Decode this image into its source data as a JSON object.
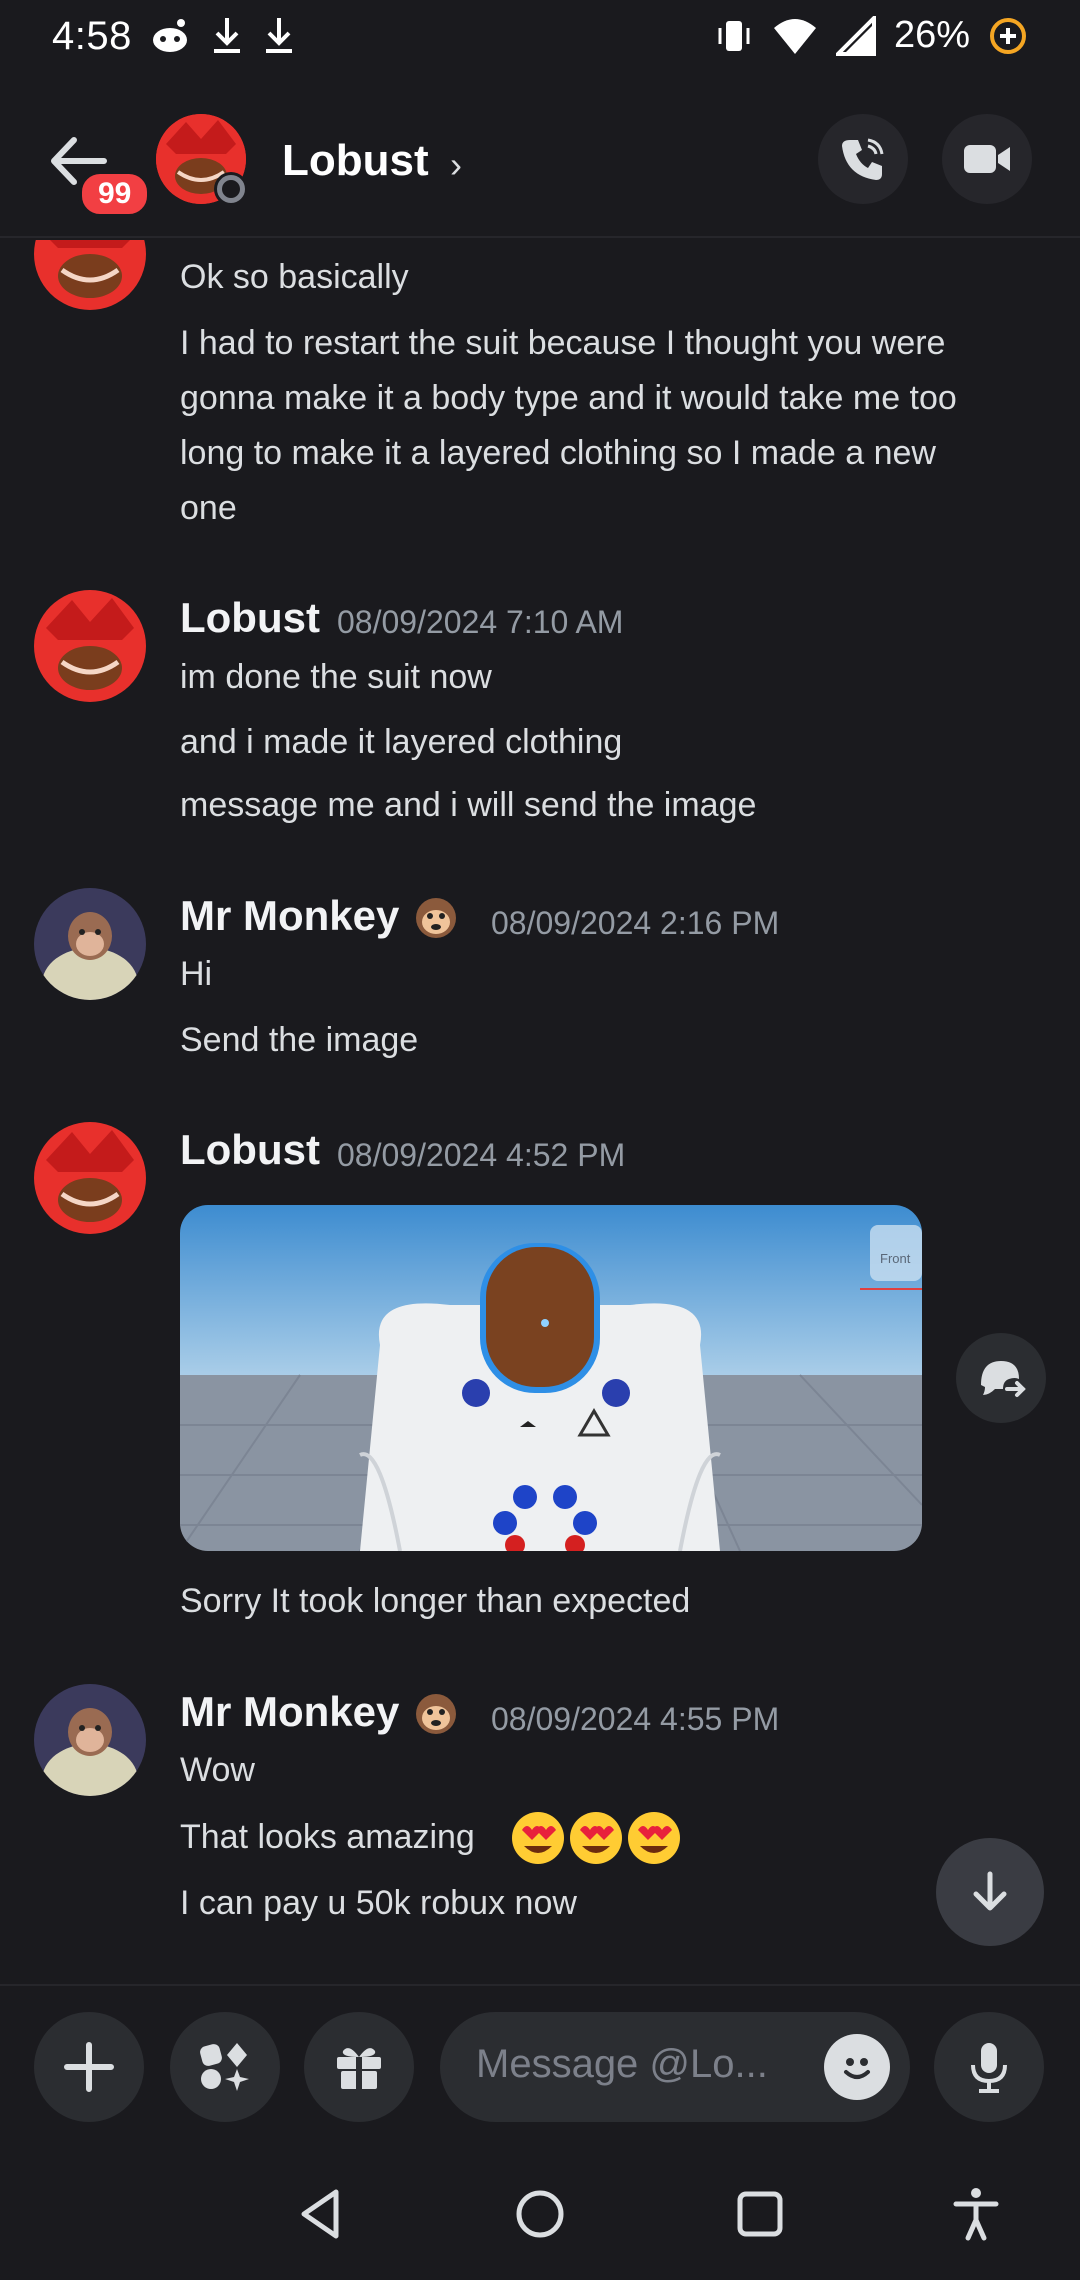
{
  "status_bar": {
    "time": "4:58",
    "battery": "26%"
  },
  "header": {
    "unread_count": "99",
    "name": "Lobust",
    "chevron": "›"
  },
  "messages": [
    {
      "id": "cont",
      "lines": [
        "Ok so basically",
        "I had to restart the suit because I thought you were",
        "gonna make it a body type and it would take me too",
        "long to make it a layered clothing so I made a new",
        "one"
      ]
    },
    {
      "id": "m1",
      "author": "Lobust",
      "timestamp": "08/09/2024 7:10 AM",
      "lines": [
        "im done the suit now",
        "and i made it layered clothing",
        "message me and i will send the image"
      ]
    },
    {
      "id": "m2",
      "author": "Mr Monkey",
      "author_emoji": "🐵",
      "timestamp": "08/09/2024 2:16 PM",
      "lines": [
        "Hi",
        "Send the image"
      ]
    },
    {
      "id": "m3",
      "author": "Lobust",
      "timestamp": "08/09/2024 4:52 PM",
      "attachment_label": "Front",
      "lines": [
        "Sorry It took longer than expected"
      ]
    },
    {
      "id": "m4",
      "author": "Mr Monkey",
      "author_emoji": "🐵",
      "timestamp": "08/09/2024 4:55 PM",
      "lines": [
        "Wow",
        "That looks amazing",
        "I can pay u 50k robux now"
      ]
    }
  ],
  "composer": {
    "placeholder": "Message @Lo..."
  },
  "colors": {
    "background": "#1a1a1e",
    "accent_red": "#f23f43",
    "text": "#dbdee1",
    "muted": "#949ba4"
  }
}
